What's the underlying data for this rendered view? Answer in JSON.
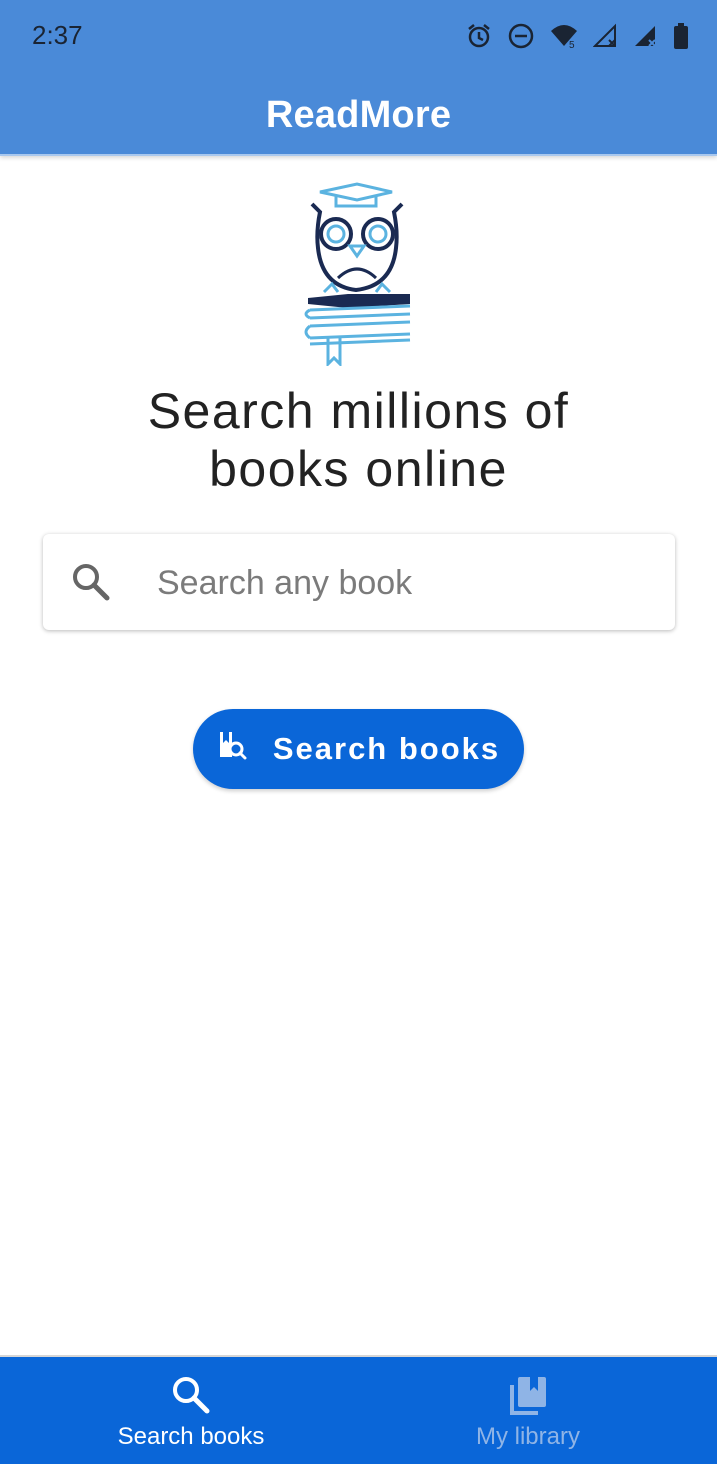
{
  "status_bar": {
    "time": "2:37",
    "icons": [
      "alarm-icon",
      "do-not-disturb-icon",
      "wifi-icon",
      "signal-icon",
      "signal-icon",
      "battery-icon"
    ]
  },
  "app_bar": {
    "title": "ReadMore",
    "color": "#4a8ad8"
  },
  "hero": {
    "logo": "owl-on-books-logo",
    "headline_line1": "Search millions of",
    "headline_line2": "books online"
  },
  "search": {
    "placeholder": "Search any book",
    "value": "",
    "icon": "search-icon"
  },
  "search_button": {
    "label": "Search books",
    "icon": "book-search-icon",
    "color": "#0a66d8"
  },
  "bottom_nav": {
    "color": "#0a66d8",
    "items": [
      {
        "label": "Search books",
        "icon": "search-icon",
        "active": true
      },
      {
        "label": "My library",
        "icon": "library-icon",
        "active": false
      }
    ]
  }
}
